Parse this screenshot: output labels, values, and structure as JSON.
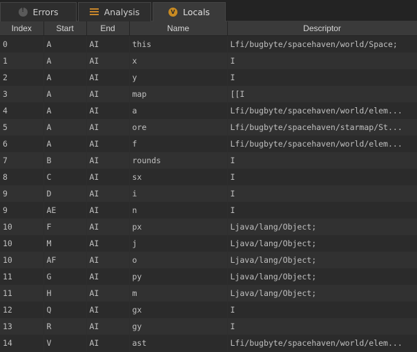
{
  "tabs": [
    {
      "label": "Errors",
      "icon": "error-icon"
    },
    {
      "label": "Analysis",
      "icon": "analysis-icon"
    },
    {
      "label": "Locals",
      "icon": "locals-icon"
    }
  ],
  "active_tab": "Locals",
  "columns": [
    "Index",
    "Start",
    "End",
    "Name",
    "Descriptor"
  ],
  "rows": [
    [
      "0",
      "A",
      "AI",
      "this",
      "Lfi/bugbyte/spacehaven/world/Space;"
    ],
    [
      "1",
      "A",
      "AI",
      "x",
      "I"
    ],
    [
      "2",
      "A",
      "AI",
      "y",
      "I"
    ],
    [
      "3",
      "A",
      "AI",
      "map",
      "[[I"
    ],
    [
      "4",
      "A",
      "AI",
      "a",
      "Lfi/bugbyte/spacehaven/world/elem..."
    ],
    [
      "5",
      "A",
      "AI",
      "ore",
      "Lfi/bugbyte/spacehaven/starmap/St..."
    ],
    [
      "6",
      "A",
      "AI",
      "f",
      "Lfi/bugbyte/spacehaven/world/elem..."
    ],
    [
      "7",
      "B",
      "AI",
      "rounds",
      "I"
    ],
    [
      "8",
      "C",
      "AI",
      "sx",
      "I"
    ],
    [
      "9",
      "D",
      "AI",
      "i",
      "I"
    ],
    [
      "9",
      "AE",
      "AI",
      "n",
      "I"
    ],
    [
      "10",
      "F",
      "AI",
      "px",
      "Ljava/lang/Object;"
    ],
    [
      "10",
      "M",
      "AI",
      "j",
      "Ljava/lang/Object;"
    ],
    [
      "10",
      "AF",
      "AI",
      "o",
      "Ljava/lang/Object;"
    ],
    [
      "11",
      "G",
      "AI",
      "py",
      "Ljava/lang/Object;"
    ],
    [
      "11",
      "H",
      "AI",
      "m",
      "Ljava/lang/Object;"
    ],
    [
      "12",
      "Q",
      "AI",
      "gx",
      "I"
    ],
    [
      "13",
      "R",
      "AI",
      "gy",
      "I"
    ],
    [
      "14",
      "V",
      "AI",
      "ast",
      "Lfi/bugbyte/spacehaven/world/elem..."
    ]
  ],
  "colors": {
    "background": "#2b2b2b",
    "row_alt": "#313131",
    "header": "#3a3a3a",
    "accent": "#c98b22"
  }
}
